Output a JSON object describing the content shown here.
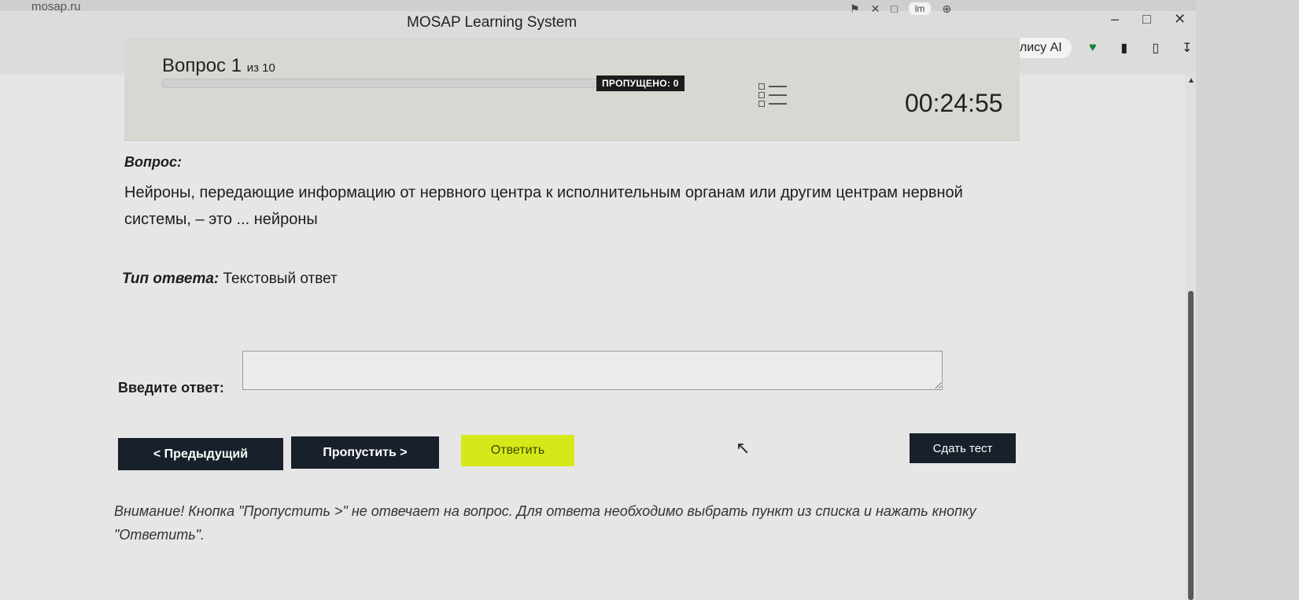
{
  "browser": {
    "address_text": "mosap.ru",
    "window_title": "MOSAP Learning System",
    "tab_chip": "lm",
    "alice_label": "Спросить Алису AI"
  },
  "header": {
    "question_word": "Вопрос 1",
    "question_of": "из 10",
    "skipped_label": "ПРОПУЩЕНО: 0",
    "timer": "00:24:55",
    "progress_value": 0.0
  },
  "question": {
    "label": "Вопрос:",
    "text": "Нейроны, передающие информацию от нервного центра к исполнительным органам или другим центрам нервной системы, – это ... нейроны"
  },
  "answer_type": {
    "label": "Тип ответа:",
    "value": "Текстовый ответ"
  },
  "answer": {
    "label": "Введите ответ:",
    "value": ""
  },
  "buttons": {
    "prev": "< Предыдущий",
    "skip": "Пропустить >",
    "answer": "Ответить",
    "submit": "Сдать тест"
  },
  "warning": "Внимание! Кнопка \"Пропустить >\" не отвечает на вопрос. Для ответа необходимо выбрать пункт из списка и нажать кнопку \"Ответить\"."
}
